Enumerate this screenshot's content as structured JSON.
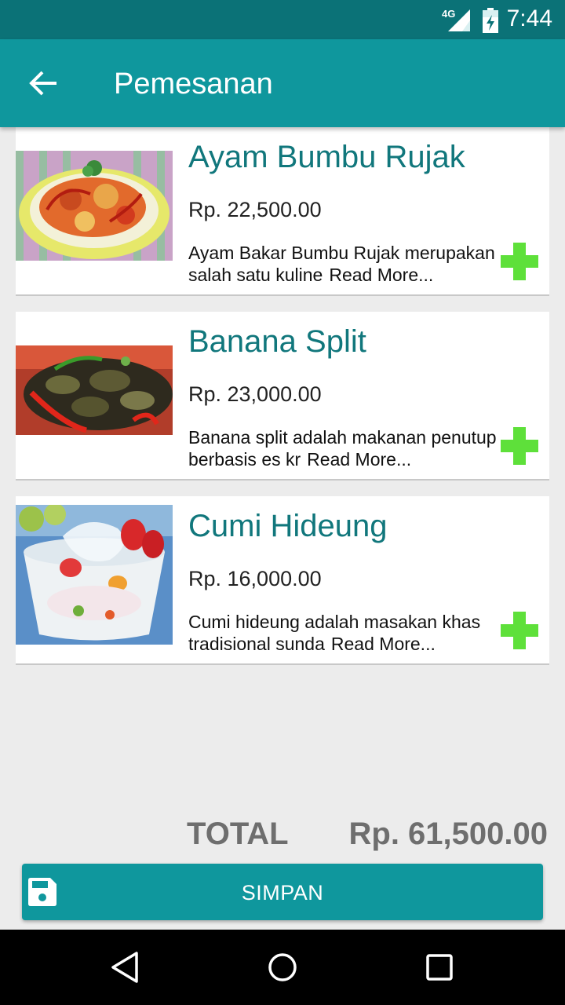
{
  "status_bar": {
    "network": "4G",
    "time": "7:44"
  },
  "app_bar": {
    "title": "Pemesanan",
    "back_icon": "arrow-left-icon"
  },
  "menu_items": [
    {
      "name": "Ayam Bumbu Rujak",
      "price": "Rp. 22,500.00",
      "description": "Ayam Bakar Bumbu Rujak merupakan salah satu kuline",
      "read_more": "Read More...",
      "image": "food-photo-chicken-bumbu-rujak"
    },
    {
      "name": "Banana Split",
      "price": "Rp. 23,000.00",
      "description": "Banana split adalah makanan penutup berbasis es kr",
      "read_more": "Read More...",
      "image": "food-photo-squid-with-chili"
    },
    {
      "name": "Cumi Hideung",
      "price": "Rp. 16,000.00",
      "description": "Cumi hideung adalah masakan khas tradisional sunda",
      "read_more": "Read More...",
      "image": "food-photo-iced-fruit-dessert"
    }
  ],
  "total": {
    "label": "TOTAL",
    "value": "Rp. 61,500.00"
  },
  "save_button": {
    "label": "SIMPAN",
    "icon": "save-icon"
  },
  "colors": {
    "primary": "#0f979d",
    "primary_dark": "#0b7277",
    "title_text": "#11777c",
    "add_icon": "#5ee03a",
    "total_text": "#6e6e6e"
  }
}
